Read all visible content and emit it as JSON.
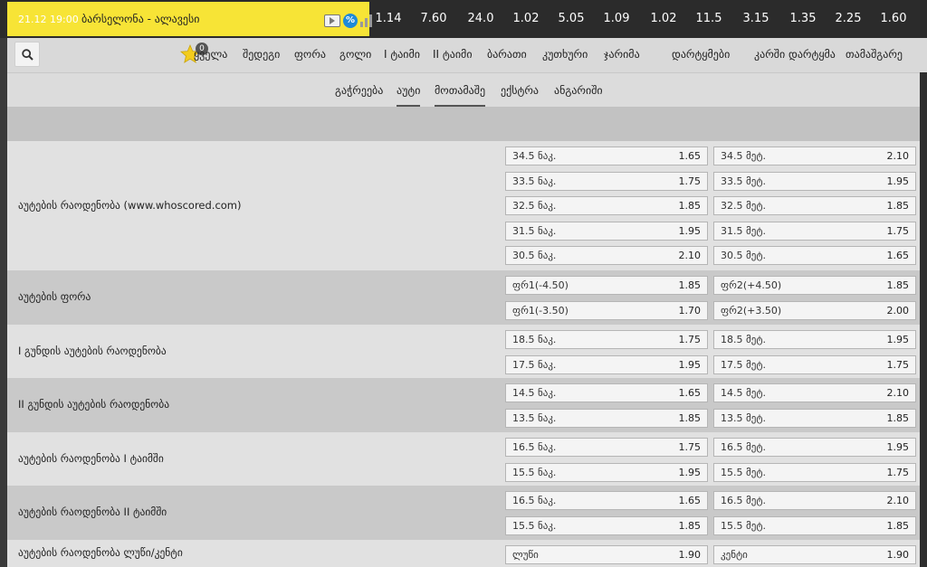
{
  "match": {
    "time": "21.12 19:00",
    "name": "ბარსელონა - ალავესი",
    "top_odds": [
      "1.14",
      "7.60",
      "24.0",
      "1.02",
      "5.05",
      "1.09",
      "1.02",
      "11.5",
      "3.15",
      "1.35",
      "2.25",
      "1.60"
    ]
  },
  "icons": {
    "percent_label": "%"
  },
  "nav": {
    "favorites_count": "0",
    "items": [
      "ყველა",
      "შედეგი",
      "ფორა",
      "გოლი",
      "I ტაიმი",
      "II ტაიმი",
      "ბარათი",
      "კუთხური",
      "ჯარიმა",
      "დარტყმები",
      "კარში დარტყმა",
      "თამაშგარე"
    ]
  },
  "tabs": [
    "გაჭრეება",
    "აუტი",
    "მოთამაშე",
    "ექსტრა",
    "ანგარიში"
  ],
  "active_tabs": [
    1,
    2
  ],
  "markets": [
    {
      "title": "აუტების რაოდენობა (www.whoscored.com)",
      "rows": [
        [
          {
            "label": "34.5 ნაკ.",
            "odd": "1.65"
          },
          {
            "label": "34.5 მეტ.",
            "odd": "2.10"
          }
        ],
        [
          {
            "label": "33.5 ნაკ.",
            "odd": "1.75"
          },
          {
            "label": "33.5 მეტ.",
            "odd": "1.95"
          }
        ],
        [
          {
            "label": "32.5 ნაკ.",
            "odd": "1.85"
          },
          {
            "label": "32.5 მეტ.",
            "odd": "1.85"
          }
        ],
        [
          {
            "label": "31.5 ნაკ.",
            "odd": "1.95"
          },
          {
            "label": "31.5 მეტ.",
            "odd": "1.75"
          }
        ],
        [
          {
            "label": "30.5 ნაკ.",
            "odd": "2.10"
          },
          {
            "label": "30.5 მეტ.",
            "odd": "1.65"
          }
        ]
      ]
    },
    {
      "title": "აუტების ფორა",
      "rows": [
        [
          {
            "label": "ფრ1(-4.50)",
            "odd": "1.85"
          },
          {
            "label": "ფრ2(+4.50)",
            "odd": "1.85"
          }
        ],
        [
          {
            "label": "ფრ1(-3.50)",
            "odd": "1.70"
          },
          {
            "label": "ფრ2(+3.50)",
            "odd": "2.00"
          }
        ]
      ]
    },
    {
      "title": "I გუნდის აუტების რაოდენობა",
      "rows": [
        [
          {
            "label": "18.5 ნაკ.",
            "odd": "1.75"
          },
          {
            "label": "18.5 მეტ.",
            "odd": "1.95"
          }
        ],
        [
          {
            "label": "17.5 ნაკ.",
            "odd": "1.95"
          },
          {
            "label": "17.5 მეტ.",
            "odd": "1.75"
          }
        ]
      ]
    },
    {
      "title": "II გუნდის აუტების რაოდენობა",
      "rows": [
        [
          {
            "label": "14.5 ნაკ.",
            "odd": "1.65"
          },
          {
            "label": "14.5 მეტ.",
            "odd": "2.10"
          }
        ],
        [
          {
            "label": "13.5 ნაკ.",
            "odd": "1.85"
          },
          {
            "label": "13.5 მეტ.",
            "odd": "1.85"
          }
        ]
      ]
    },
    {
      "title": "აუტების რაოდენობა I ტაიმში",
      "rows": [
        [
          {
            "label": "16.5 ნაკ.",
            "odd": "1.75"
          },
          {
            "label": "16.5 მეტ.",
            "odd": "1.95"
          }
        ],
        [
          {
            "label": "15.5 ნაკ.",
            "odd": "1.95"
          },
          {
            "label": "15.5 მეტ.",
            "odd": "1.75"
          }
        ]
      ]
    },
    {
      "title": "აუტების რაოდენობა II ტაიმში",
      "rows": [
        [
          {
            "label": "16.5 ნაკ.",
            "odd": "1.65"
          },
          {
            "label": "16.5 მეტ.",
            "odd": "2.10"
          }
        ],
        [
          {
            "label": "15.5 ნაკ.",
            "odd": "1.85"
          },
          {
            "label": "15.5 მეტ.",
            "odd": "1.85"
          }
        ]
      ]
    },
    {
      "title": "აუტების რაოდენობა ლუწი/კენტი",
      "rows": [
        [
          {
            "label": "ლუწი",
            "odd": "1.90"
          },
          {
            "label": "კენტი",
            "odd": "1.90"
          }
        ]
      ]
    }
  ],
  "colors": {
    "accent_yellow": "#f7e436",
    "dark_bg": "#2b2b2b",
    "percent_blue": "#1e8ad8"
  }
}
